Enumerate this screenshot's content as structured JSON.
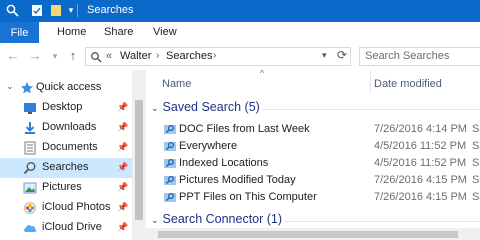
{
  "window": {
    "title": "Searches"
  },
  "ribbon": {
    "file_label": "File",
    "tabs": [
      "Home",
      "Share",
      "View"
    ]
  },
  "address": {
    "prefix": "«",
    "crumbs": [
      "Walter",
      "Searches"
    ]
  },
  "search": {
    "placeholder": "Search Searches"
  },
  "nav": {
    "items": [
      {
        "label": "Quick access",
        "icon": "star-icon"
      },
      {
        "label": "Desktop",
        "icon": "desktop-icon",
        "pinned": true
      },
      {
        "label": "Downloads",
        "icon": "download-icon",
        "pinned": true
      },
      {
        "label": "Documents",
        "icon": "documents-icon",
        "pinned": true
      },
      {
        "label": "Searches",
        "icon": "search-folder-icon",
        "pinned": true,
        "selected": true
      },
      {
        "label": "Pictures",
        "icon": "pictures-icon",
        "pinned": true
      },
      {
        "label": "iCloud Photos",
        "icon": "icloud-photos-icon",
        "pinned": true
      },
      {
        "label": "iCloud Drive",
        "icon": "icloud-drive-icon",
        "pinned": true
      }
    ],
    "pin_glyph": "📌"
  },
  "columns": {
    "name": "Name",
    "date": "Date modified"
  },
  "groups": [
    {
      "label": "Saved Search (5)",
      "files": [
        {
          "name": "DOC Files from Last Week",
          "date": "7/26/2016 4:14 PM",
          "type": "Sa"
        },
        {
          "name": "Everywhere",
          "date": "4/5/2016 11:52 PM",
          "type": "Sa"
        },
        {
          "name": "Indexed Locations",
          "date": "4/5/2016 11:52 PM",
          "type": "Sa"
        },
        {
          "name": "Pictures Modified Today",
          "date": "7/26/2016 4:15 PM",
          "type": "Sa"
        },
        {
          "name": "PPT Files on This Computer",
          "date": "7/26/2016 4:15 PM",
          "type": "Sa"
        }
      ]
    },
    {
      "label": "Search Connector (1)",
      "files": []
    }
  ],
  "colors": {
    "titlebar": "#0a69c9",
    "file_tab": "#1a73d4",
    "selected": "#cce8ff",
    "group_text": "#1e3287"
  }
}
